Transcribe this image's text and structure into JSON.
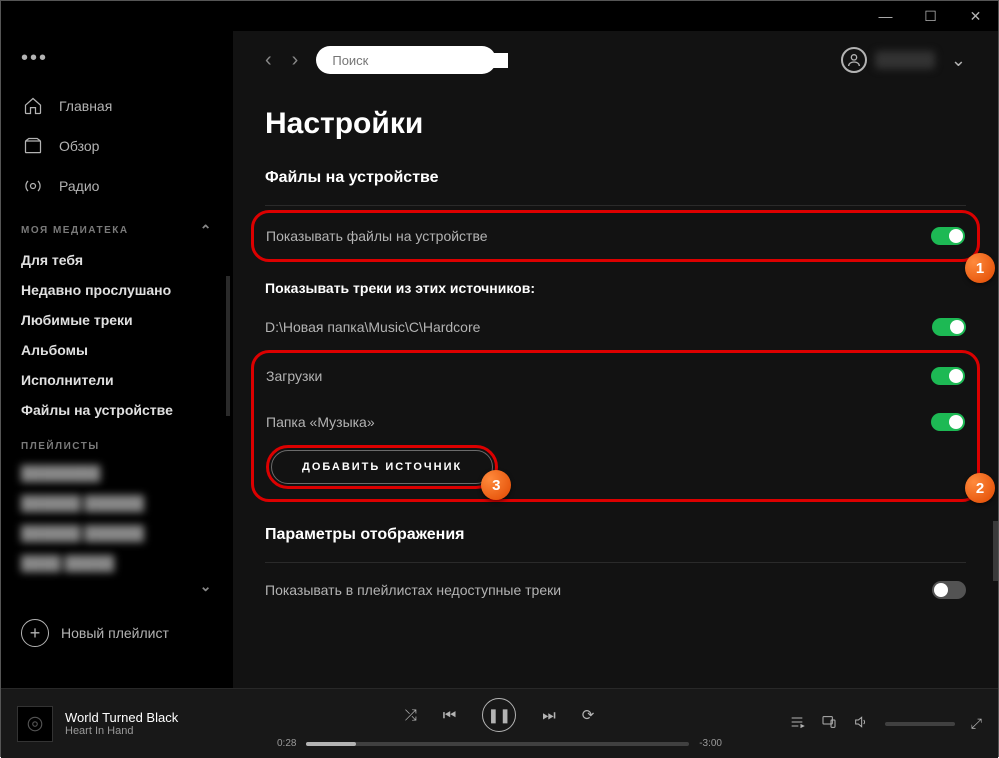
{
  "window": {
    "minimize": "—",
    "maximize": "☐",
    "close": "✕"
  },
  "search": {
    "placeholder": "Поиск"
  },
  "sidebar": {
    "nav": [
      {
        "label": "Главная",
        "icon": "home"
      },
      {
        "label": "Обзор",
        "icon": "browse"
      },
      {
        "label": "Радио",
        "icon": "radio"
      }
    ],
    "library_header": "МОЯ МЕДИАТЕКА",
    "library": [
      "Для тебя",
      "Недавно прослушано",
      "Любимые треки",
      "Альбомы",
      "Исполнители",
      "Файлы на устройстве"
    ],
    "playlists_header": "ПЛЕЙЛИСТЫ",
    "playlists": [
      "████████",
      "██████ ██████",
      "██████ ██████",
      "████ █████"
    ],
    "new_playlist": "Новый плейлист"
  },
  "page": {
    "title": "Настройки",
    "section1_title": "Файлы на устройстве",
    "show_local": "Показывать файлы на устройстве",
    "sources_title": "Показывать треки из этих источников:",
    "sources": [
      {
        "label": "D:\\Новая папка\\Music\\С\\Hardcore",
        "on": true
      },
      {
        "label": "Загрузки",
        "on": true
      },
      {
        "label": "Папка «Музыка»",
        "on": true
      }
    ],
    "add_source": "ДОБАВИТЬ ИСТОЧНИК",
    "section2_title": "Параметры отображения",
    "show_unavailable": "Показывать в плейлистах недоступные треки",
    "badges": {
      "b1": "1",
      "b2": "2",
      "b3": "3"
    }
  },
  "player": {
    "track": "World Turned Black",
    "artist": "Heart In Hand",
    "elapsed": "0:28",
    "remaining": "-3:00"
  }
}
